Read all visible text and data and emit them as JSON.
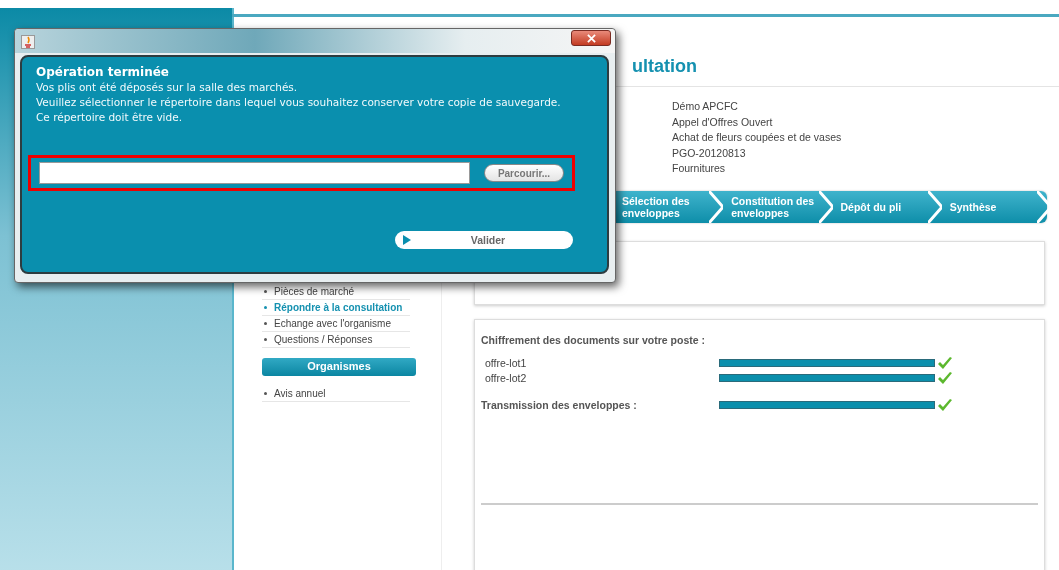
{
  "page": {
    "title_visible": "ultation",
    "info": [
      "Démo APCFC",
      "Appel d'Offres Ouvert",
      "Achat de fleurs coupées et de vases",
      "PGO-20120813",
      "Fournitures"
    ],
    "steps": [
      {
        "label": "Sélection des enveloppes"
      },
      {
        "label": "Constitution des enveloppes"
      },
      {
        "label": "Dépôt du pli"
      },
      {
        "label": "Synthèse"
      }
    ],
    "menu": [
      {
        "label": "Pièces de marché",
        "selected": false
      },
      {
        "label": "Répondre à la consultation",
        "selected": true
      },
      {
        "label": "Echange avec l'organisme",
        "selected": false
      },
      {
        "label": "Questions / Réponses",
        "selected": false
      }
    ],
    "organismes": {
      "title": "Organismes",
      "items": [
        "Avis annuel"
      ]
    },
    "encryption": {
      "title": "Chiffrement des documents sur votre poste :",
      "files": [
        {
          "name": "offre-lot1",
          "level": 1,
          "done": true
        },
        {
          "name": "offre-lot2",
          "level": 1,
          "done": true
        }
      ]
    },
    "transmission": {
      "title": "Transmission des enveloppes :",
      "level": 1,
      "done": true
    }
  },
  "dialog": {
    "heading": "Opération terminée",
    "lines": [
      "Vos plis ont été déposés sur la salle des marchés.",
      "Veuillez sélectionner le répertoire dans lequel vous souhaitez conserver votre copie de sauvegarde.",
      "Ce répertoire doit être vide."
    ],
    "browse_button": "Parcourir...",
    "validate_button": "Valider",
    "highlighted": true
  }
}
